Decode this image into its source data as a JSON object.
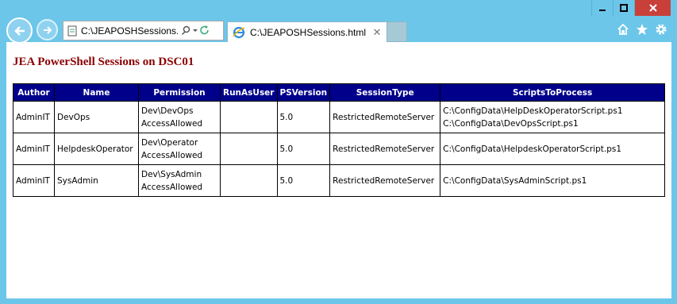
{
  "browser": {
    "address": "C:\\JEAPOSHSessions.htı",
    "tab_title": "C:\\JEAPOSHSessions.html"
  },
  "page": {
    "title": "JEA PowerShell Sessions on DSC01"
  },
  "table": {
    "headers": [
      "Author",
      "Name",
      "Permission",
      "RunAsUser",
      "PSVersion",
      "SessionType",
      "ScriptsToProcess"
    ],
    "rows": [
      {
        "author": "AdminIT",
        "name": "DevOps",
        "permission": [
          "Dev\\DevOps",
          "AccessAllowed"
        ],
        "runasuser": "",
        "psversion": "5.0",
        "sessiontype": "RestrictedRemoteServer",
        "scripts": [
          "C:\\ConfigData\\HelpDeskOperatorScript.ps1",
          "C:\\ConfigData\\DevOpsScript.ps1"
        ]
      },
      {
        "author": "AdminIT",
        "name": "HelpdeskOperator",
        "permission": [
          "Dev\\Operator",
          "AccessAllowed"
        ],
        "runasuser": "",
        "psversion": "5.0",
        "sessiontype": "RestrictedRemoteServer",
        "scripts": [
          "C:\\ConfigData\\HelpdeskOperatorScript.ps1",
          ""
        ]
      },
      {
        "author": "AdminIT",
        "name": "SysAdmin",
        "permission": [
          "Dev\\SysAdmin",
          "AccessAllowed"
        ],
        "runasuser": "",
        "psversion": "5.0",
        "sessiontype": "RestrictedRemoteServer",
        "scripts": [
          "C:\\ConfigData\\SysAdminScript.ps1",
          ""
        ]
      }
    ]
  },
  "colors": {
    "title": "#8b0000",
    "header_bg": "#00008b",
    "chrome": "#6cc6ea"
  }
}
